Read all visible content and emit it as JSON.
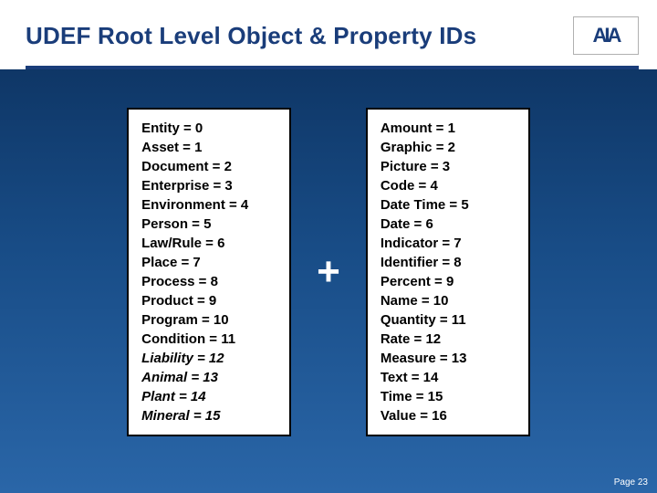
{
  "title": "UDEF Root Level Object & Property IDs",
  "logo": "AIA",
  "objects": [
    {
      "text": "Entity = 0",
      "italic": false
    },
    {
      "text": "Asset  =  1",
      "italic": false
    },
    {
      "text": "Document  =  2",
      "italic": false
    },
    {
      "text": "Enterprise  =  3",
      "italic": false
    },
    {
      "text": "Environment  =  4",
      "italic": false
    },
    {
      "text": "Person  =  5",
      "italic": false
    },
    {
      "text": "Law/Rule  =  6",
      "italic": false
    },
    {
      "text": "Place = 7",
      "italic": false
    },
    {
      "text": "Process  =  8",
      "italic": false
    },
    {
      "text": "Product  =  9",
      "italic": false
    },
    {
      "text": "Program  =  10",
      "italic": false
    },
    {
      "text": "Condition = 11",
      "italic": false
    },
    {
      "text": "Liability = 12",
      "italic": true
    },
    {
      "text": "Animal = 13",
      "italic": true
    },
    {
      "text": "Plant = 14",
      "italic": true
    },
    {
      "text": "Mineral = 15",
      "italic": true
    }
  ],
  "plus": "+",
  "properties": [
    {
      "text": "Amount  =  1"
    },
    {
      "text": "Graphic  =  2"
    },
    {
      "text": "Picture  =  3"
    },
    {
      "text": "Code  =  4"
    },
    {
      "text": "Date Time  =  5"
    },
    {
      "text": "Date  =  6"
    },
    {
      "text": "Indicator  =  7"
    },
    {
      "text": "Identifier  =  8"
    },
    {
      "text": "Percent  =  9"
    },
    {
      "text": "Name  =  10"
    },
    {
      "text": "Quantity  =  11"
    },
    {
      "text": "Rate  =  12"
    },
    {
      "text": "Measure  =  13"
    },
    {
      "text": "Text  =  14"
    },
    {
      "text": "Time  =  15"
    },
    {
      "text": "Value  =  16"
    }
  ],
  "page": "Page 23"
}
